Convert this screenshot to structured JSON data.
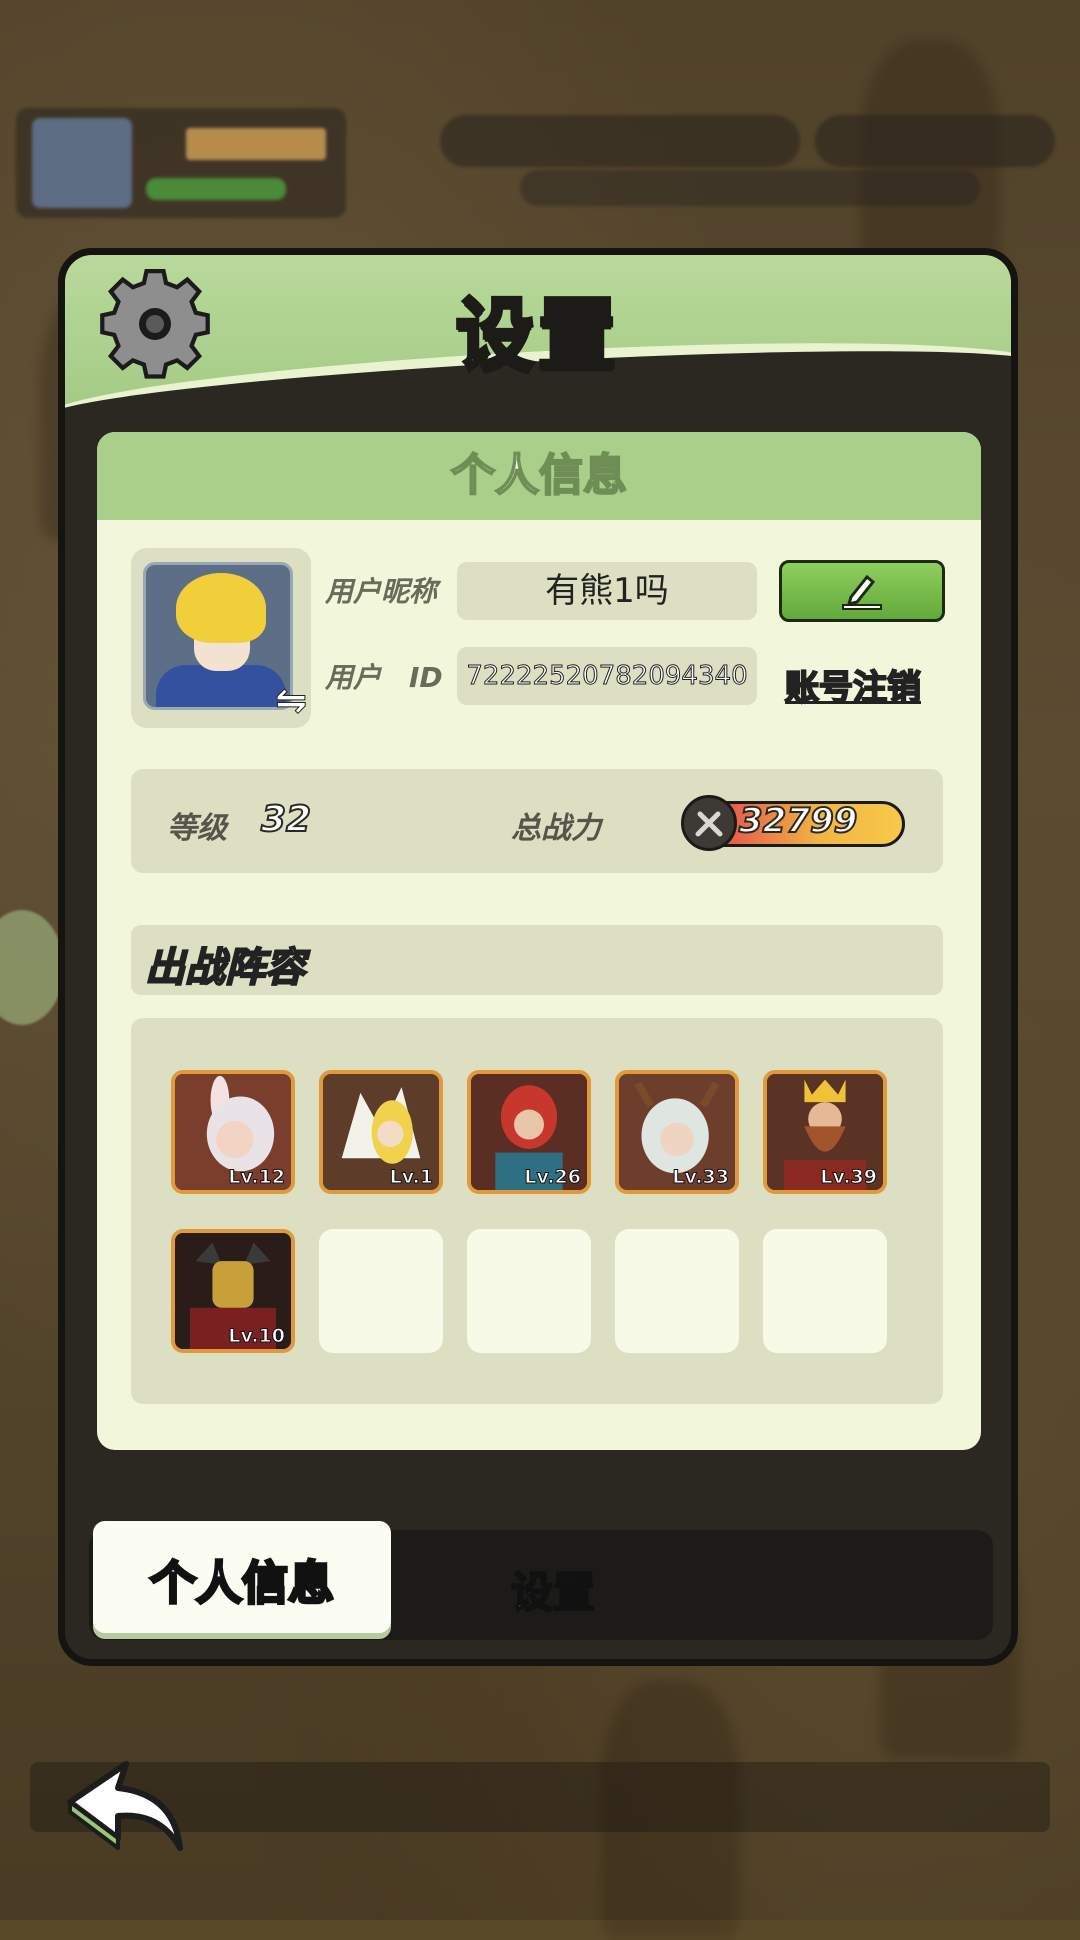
{
  "panel": {
    "title": "设置"
  },
  "profile": {
    "section_title": "个人信息",
    "nickname_label": "用户昵称",
    "nickname_value": "有熊1吗",
    "id_label": "用户　ID",
    "id_value": "7222252078209434​0",
    "logout_label": "账号注销"
  },
  "stats": {
    "level_label": "等级",
    "level_value": "32",
    "power_label": "总战力",
    "power_value": "32799"
  },
  "lineup": {
    "title": "出战阵容",
    "heroes": [
      {
        "level": "Lv.12"
      },
      {
        "level": "Lv.1"
      },
      {
        "level": "Lv.26"
      },
      {
        "level": "Lv.33"
      },
      {
        "level": "Lv.39"
      },
      {
        "level": "Lv.10"
      }
    ],
    "empty_slots": 4
  },
  "tabs": {
    "profile_label": "个人信息",
    "settings_label": "设置"
  },
  "colors": {
    "header_green": "#a5cb86",
    "card_bg": "#f2f7dc",
    "edit_button": "#62a93a",
    "frame_orange": "#e09a3c"
  },
  "icons": [
    "gear-icon",
    "pencil-icon",
    "swap-icon",
    "sword-icon",
    "back-arrow-icon"
  ]
}
